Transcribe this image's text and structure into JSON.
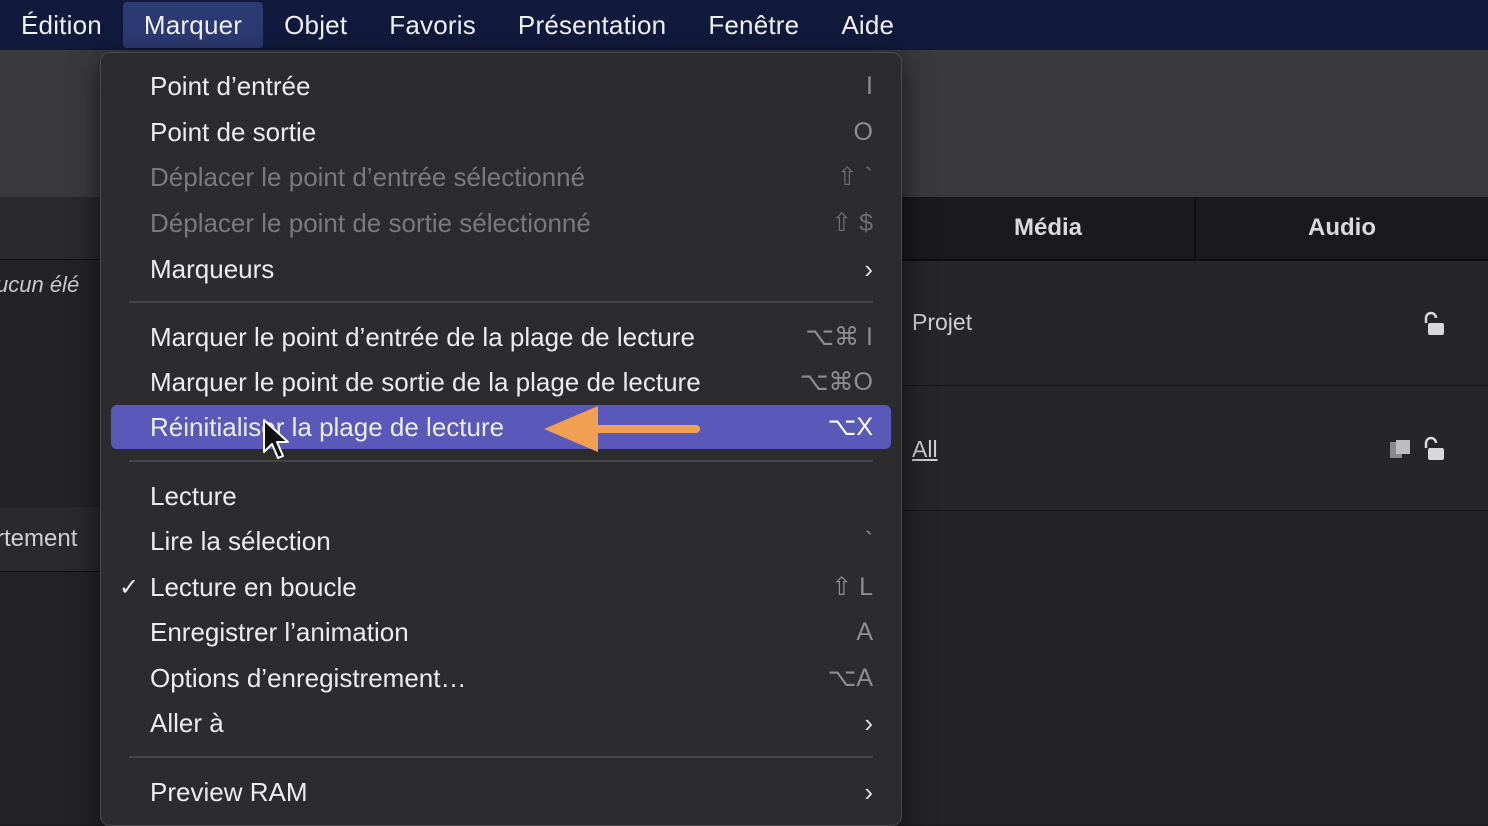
{
  "menubar": {
    "items": [
      {
        "label": "Édition"
      },
      {
        "label": "Marquer",
        "active": true
      },
      {
        "label": "Objet"
      },
      {
        "label": "Favoris"
      },
      {
        "label": "Présentation"
      },
      {
        "label": "Fenêtre"
      },
      {
        "label": "Aide"
      }
    ]
  },
  "left_panel": {
    "empty_text": "ucun élé",
    "section_text": "rtement"
  },
  "right_panel": {
    "tabs": [
      {
        "label": "Média"
      },
      {
        "label": "Audio"
      }
    ],
    "rows": [
      {
        "label": "Projet",
        "icon": "unlock-icon"
      },
      {
        "label": "All",
        "icon": "unlock-icon"
      }
    ]
  },
  "menu": {
    "items": [
      {
        "label": "Point d’entrée",
        "shortcut": "I"
      },
      {
        "label": "Point de sortie",
        "shortcut": "O"
      },
      {
        "label": "Déplacer le point d’entrée sélectionné",
        "shortcut": "⇧ `",
        "disabled": true
      },
      {
        "label": "Déplacer le point de sortie sélectionné",
        "shortcut": "⇧ $",
        "disabled": true
      },
      {
        "label": "Marqueurs",
        "submenu": true
      },
      {
        "label": "Marquer le point d’entrée de la plage de lecture",
        "shortcut": "⌥⌘ I"
      },
      {
        "label": "Marquer le point de sortie de la plage de lecture",
        "shortcut": "⌥⌘O"
      },
      {
        "label": "Réinitialiser la plage de lecture",
        "shortcut": "⌥X",
        "selected": true
      },
      {
        "label": "Lecture",
        "shortcut": ""
      },
      {
        "label": "Lire la sélection",
        "shortcut": "`"
      },
      {
        "label": "Lecture en boucle",
        "shortcut": "⇧ L",
        "checked": true
      },
      {
        "label": "Enregistrer l’animation",
        "shortcut": "A"
      },
      {
        "label": "Options d’enregistrement…",
        "shortcut": "⌥A"
      },
      {
        "label": "Aller à",
        "submenu": true
      },
      {
        "label": "Preview RAM",
        "submenu": true
      }
    ],
    "check_glyph": "✓",
    "submenu_glyph": "›"
  },
  "colors": {
    "menubar_bg": "#111a3c",
    "selection": "#5a58b8",
    "annotation_arrow": "#f0a050"
  }
}
